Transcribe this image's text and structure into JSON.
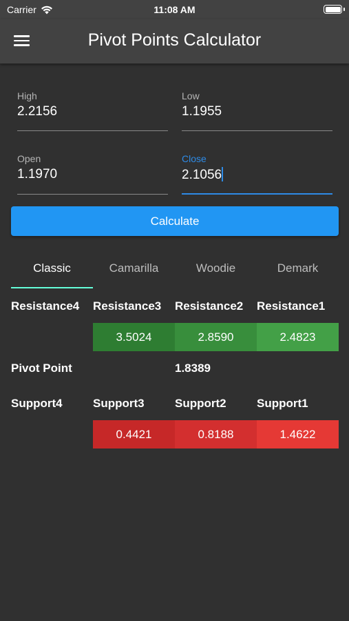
{
  "status": {
    "carrier": "Carrier",
    "time": "11:08 AM"
  },
  "appbar": {
    "title": "Pivot Points Calculator",
    "menu_icon": "hamburger-menu-icon"
  },
  "form": {
    "high": {
      "label": "High",
      "value": "2.2156"
    },
    "low": {
      "label": "Low",
      "value": "1.1955"
    },
    "open": {
      "label": "Open",
      "value": "1.1970"
    },
    "close": {
      "label": "Close",
      "value": "2.1056"
    }
  },
  "calculate_label": "Calculate",
  "tabs": [
    "Classic",
    "Camarilla",
    "Woodie",
    "Demark"
  ],
  "selected_tab": "Classic",
  "results": {
    "resistance_headers": [
      "Resistance4",
      "Resistance3",
      "Resistance2",
      "Resistance1"
    ],
    "resistance_values": [
      "",
      "3.5024",
      "2.8590",
      "2.4823"
    ],
    "pivot_label": "Pivot Point",
    "pivot_value": "1.8389",
    "support_headers": [
      "Support4",
      "Support3",
      "Support2",
      "Support1"
    ],
    "support_values": [
      "",
      "0.4421",
      "0.8188",
      "1.4622"
    ]
  },
  "colors": {
    "accent_blue": "#2196f3",
    "tab_indicator": "#64ffda",
    "resistance": [
      "#2e7d32",
      "#388e3c",
      "#43a047"
    ],
    "support": [
      "#c62828",
      "#d32f2f",
      "#e53935"
    ]
  }
}
